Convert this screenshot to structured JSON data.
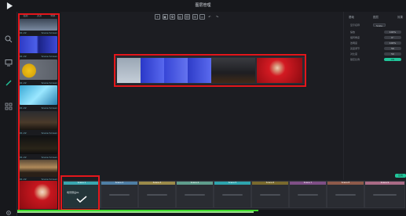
{
  "window": {
    "title": "图层管理"
  },
  "thumbs": {
    "tabs": [
      "图层",
      "资源",
      "效果"
    ],
    "items": [
      {
        "caption_left": "01:22",
        "caption_right": "Scene Screen"
      },
      {
        "caption_left": "01:22",
        "caption_right": "Scene Screen"
      },
      {
        "caption_left": "01:22",
        "caption_right": "Scene Screen"
      },
      {
        "caption_left": "01:22",
        "caption_right": "Scene Screen"
      },
      {
        "caption_left": "01:22",
        "caption_right": "Scene Screen"
      },
      {
        "caption_left": "01:22",
        "caption_right": "Scene Screen"
      },
      {
        "caption_left": "01:22",
        "caption_right": "Scene Screen"
      },
      {
        "caption_left": "01:22",
        "caption_right": "Scene Screen"
      }
    ]
  },
  "toolbar": {
    "icons": [
      "add",
      "cut",
      "copy",
      "paste",
      "link",
      "grid",
      "page",
      "undo",
      "redo"
    ],
    "glyphs": [
      "+",
      "▣",
      "⧉",
      "▤",
      "⛓",
      "⊞",
      "▭",
      "↶",
      "↷"
    ]
  },
  "strip": {
    "label": "Screen Layer"
  },
  "panel": {
    "tabs": [
      "基础",
      "图层",
      "效果"
    ],
    "rows": [
      {
        "label": "显示名称",
        "value": "Scale",
        "type": "box"
      },
      {
        "label": "缩放",
        "value": "100%",
        "type": "pill"
      },
      {
        "label": "旋转角度",
        "value": "0°",
        "type": "pill"
      },
      {
        "label": "透明度",
        "value": "100%",
        "type": "pill"
      },
      {
        "label": "亮度调节",
        "value": "50",
        "type": "pill"
      },
      {
        "label": "对比度",
        "value": "50",
        "type": "pill"
      },
      {
        "label": "锁定比例",
        "value": "ON",
        "type": "on"
      },
      {
        "label": "可见",
        "value": "ON",
        "type": "on"
      }
    ],
    "apply_label": "应用"
  },
  "scenes": {
    "items": [
      {
        "title": "Scene 1",
        "color": "#3aa7b0",
        "selected": true,
        "desc": "场景预设01"
      },
      {
        "title": "Scene 2",
        "color": "#4f7fa5"
      },
      {
        "title": "Scene 3",
        "color": "#9b8a4a"
      },
      {
        "title": "Scene 4",
        "color": "#5f9d8c"
      },
      {
        "title": "Scene 5",
        "color": "#2ea4ad"
      },
      {
        "title": "Scene 6",
        "color": "#7a6a2e"
      },
      {
        "title": "Scene 7",
        "color": "#7f4f86"
      },
      {
        "title": "Scene 8",
        "color": "#8e5a4a"
      },
      {
        "title": "Scene 9",
        "color": "#a96b86"
      }
    ]
  },
  "status": {
    "progress": 0.62
  },
  "colors": {
    "accent": "#21c59a",
    "highlight": "#e4161b",
    "progress": "#3fdc2a"
  }
}
